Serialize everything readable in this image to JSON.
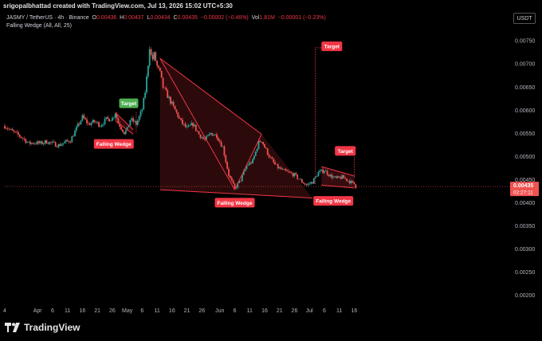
{
  "header": {
    "credit": "srigopalbhattad created with TradingView.com, Jul 13, 2026 15:02 UTC+5:30"
  },
  "legend": {
    "symbol": "JASMY / TetherUS · 4h · Binance",
    "open_label": "O",
    "open": "0.00436",
    "high_label": "H",
    "high": "0.00437",
    "low_label": "L",
    "low": "0.00434",
    "close_label": "C",
    "close": "0.00435",
    "change": "−0.00002 (−0.46%)",
    "vol_label": "Vol",
    "vol": "1.81M",
    "vol_change": "−0.00001 (−0.23%)",
    "indicator": "Falling Wedge (All, All, 25)"
  },
  "currency": "USDT",
  "price_tag": {
    "value": "0.00435",
    "countdown": "02:27:11"
  },
  "annotations": {
    "target_labels": [
      "Target",
      "Target",
      "Target"
    ],
    "wedge_labels": [
      "Falling Wedge",
      "Falling Wedge",
      "Falling Wedge"
    ]
  },
  "brand": "TradingView",
  "colors": {
    "bull": "#26a69a",
    "bear": "#ef5350",
    "pattern": "#f23645",
    "target_green": "#4caf50"
  },
  "chart_data": {
    "type": "candlestick",
    "timeframe": "4h",
    "ylim": [
      0.00175,
      0.0079
    ],
    "yticks": [
      0.0075,
      0.007,
      0.0065,
      0.006,
      0.0055,
      0.005,
      0.0045,
      0.004,
      0.0035,
      0.003,
      0.0025,
      0.002
    ],
    "ytick_labels": [
      "0.00750",
      "0.00700",
      "0.00650",
      "0.00600",
      "0.00550",
      "0.00500",
      "0.00450",
      "0.00400",
      "0.00350",
      "0.00300",
      "0.00250",
      "0.00200"
    ],
    "xlim": [
      0,
      166
    ],
    "xticks": [
      {
        "label": "4",
        "day": 0
      },
      {
        "label": "Apr",
        "day": 11
      },
      {
        "label": "6",
        "day": 16
      },
      {
        "label": "11",
        "day": 21
      },
      {
        "label": "16",
        "day": 26
      },
      {
        "label": "21",
        "day": 31
      },
      {
        "label": "26",
        "day": 36
      },
      {
        "label": "May",
        "day": 41
      },
      {
        "label": "6",
        "day": 46
      },
      {
        "label": "11",
        "day": 51
      },
      {
        "label": "16",
        "day": 56
      },
      {
        "label": "21",
        "day": 61
      },
      {
        "label": "26",
        "day": 66
      },
      {
        "label": "Jun",
        "day": 72
      },
      {
        "label": "6",
        "day": 77
      },
      {
        "label": "11",
        "day": 82
      },
      {
        "label": "16",
        "day": 87
      },
      {
        "label": "21",
        "day": 92
      },
      {
        "label": "26",
        "day": 97
      },
      {
        "label": "Jul",
        "day": 102
      },
      {
        "label": "6",
        "day": 107
      },
      {
        "label": "11",
        "day": 112
      },
      {
        "label": "16",
        "day": 117
      }
    ],
    "price_path": [
      [
        0,
        0.00566
      ],
      [
        2,
        0.00556
      ],
      [
        4,
        0.00548
      ],
      [
        6,
        0.0054
      ],
      [
        8,
        0.00528
      ],
      [
        10,
        0.0053
      ],
      [
        12,
        0.00528
      ],
      [
        14,
        0.00532
      ],
      [
        16,
        0.00528
      ],
      [
        18,
        0.00524
      ],
      [
        20,
        0.0053
      ],
      [
        22,
        0.00535
      ],
      [
        24,
        0.0056
      ],
      [
        26,
        0.00585
      ],
      [
        28,
        0.0057
      ],
      [
        30,
        0.00575
      ],
      [
        32,
        0.00568
      ],
      [
        34,
        0.0058
      ],
      [
        36,
        0.00582
      ],
      [
        37,
        0.00595
      ],
      [
        38,
        0.00572
      ],
      [
        39,
        0.00562
      ],
      [
        40,
        0.00552
      ],
      [
        41,
        0.00558
      ],
      [
        42,
        0.0058
      ],
      [
        43,
        0.00576
      ],
      [
        44,
        0.0057
      ],
      [
        45,
        0.00585
      ],
      [
        46,
        0.00602
      ],
      [
        47,
        0.0064
      ],
      [
        48,
        0.007
      ],
      [
        48.6,
        0.00745
      ],
      [
        49.2,
        0.00705
      ],
      [
        50,
        0.0072
      ],
      [
        51,
        0.00695
      ],
      [
        52,
        0.0068
      ],
      [
        53,
        0.0065
      ],
      [
        55,
        0.00625
      ],
      [
        57,
        0.006
      ],
      [
        59,
        0.00575
      ],
      [
        61,
        0.0056
      ],
      [
        63,
        0.0057
      ],
      [
        65,
        0.00548
      ],
      [
        67,
        0.00535
      ],
      [
        69,
        0.0055
      ],
      [
        71,
        0.00545
      ],
      [
        73,
        0.0052
      ],
      [
        75,
        0.0046
      ],
      [
        77,
        0.0043
      ],
      [
        79,
        0.0045
      ],
      [
        81,
        0.0048
      ],
      [
        83,
        0.0049
      ],
      [
        85,
        0.0053
      ],
      [
        86,
        0.00535
      ],
      [
        87,
        0.0052
      ],
      [
        89,
        0.00495
      ],
      [
        91,
        0.00478
      ],
      [
        93,
        0.0047
      ],
      [
        95,
        0.00465
      ],
      [
        97,
        0.0046
      ],
      [
        99,
        0.00448
      ],
      [
        101,
        0.00438
      ],
      [
        103,
        0.00445
      ],
      [
        105,
        0.00465
      ],
      [
        107,
        0.0047
      ],
      [
        109,
        0.00458
      ],
      [
        111,
        0.00452
      ],
      [
        113,
        0.00455
      ],
      [
        115,
        0.00448
      ],
      [
        117,
        0.0044
      ],
      [
        117.5,
        0.00435
      ]
    ],
    "patterns": [
      {
        "name": "Falling Wedge",
        "upper": [
          [
            37,
            0.00595
          ],
          [
            43,
            0.00558
          ]
        ],
        "lower": [
          [
            37,
            0.00577
          ],
          [
            43,
            0.00548
          ]
        ],
        "target_price": 0.00598
      },
      {
        "name": "Falling Wedge",
        "upper": [
          [
            52,
            0.00712
          ],
          [
            86,
            0.00548
          ]
        ],
        "lower": [
          [
            52,
            0.00428
          ],
          [
            103,
            0.0041
          ]
        ],
        "swing": [
          [
            52,
            0.00712
          ],
          [
            77,
            0.00428
          ],
          [
            86,
            0.00548
          ]
        ],
        "target_price": 0.00735
      },
      {
        "name": "Falling Wedge",
        "upper": [
          [
            106,
            0.00478
          ],
          [
            117,
            0.00458
          ]
        ],
        "lower": [
          [
            106,
            0.00438
          ],
          [
            117,
            0.00432
          ]
        ],
        "target_price": 0.0051
      }
    ],
    "last_price": 0.00435,
    "grid": false
  }
}
